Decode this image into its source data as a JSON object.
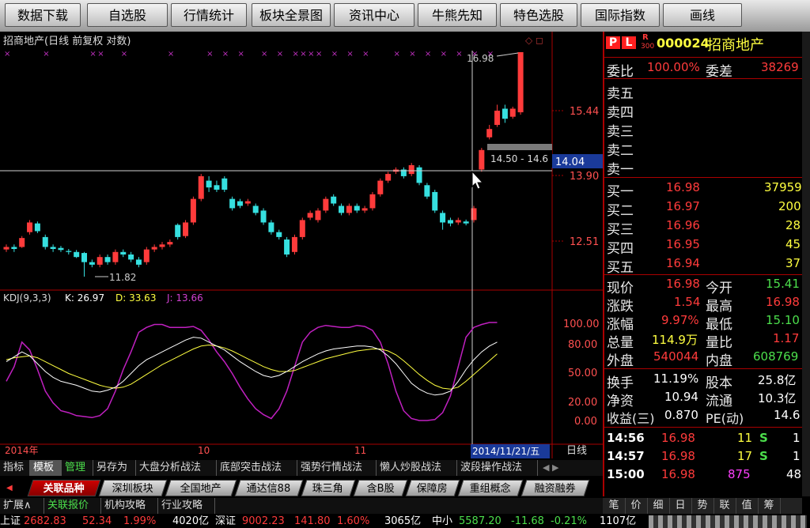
{
  "toolbar": {
    "buttons": [
      "数据下载",
      "自选股",
      "行情统计",
      "板块全景图",
      "资讯中心",
      "牛熊先知",
      "特色选股",
      "国际指数",
      "画线"
    ]
  },
  "chart": {
    "title": "招商地产(日线 前复权 对数)",
    "price_ticks": [
      "15.44",
      "13.90",
      "12.51"
    ],
    "high_label": "16.98",
    "low_label": "11.82",
    "crosshair_price": "14.04",
    "tooltip": "14.50 - 14.6",
    "kdj_header": {
      "name": "KDJ(9,3,3)",
      "k": "K: 26.97",
      "d": "D: 33.63",
      "j": "J: 13.66"
    },
    "kdj_ticks": [
      "100.00",
      "80.00",
      "50.00",
      "20.00",
      "0.00"
    ],
    "x_labels": [
      "2014年",
      "10",
      "11"
    ],
    "crosshair_date": "2014/11/21/五",
    "period": "日线"
  },
  "chart_data": [
    {
      "type": "candlestick",
      "title": "招商地产(日线 前复权 对数)",
      "price_ticks": [
        15.44,
        13.9,
        12.51
      ],
      "annotations": {
        "high": 16.98,
        "low": 11.82,
        "cursor_price": 14.04
      },
      "candles": [
        {
          "o": 12.35,
          "c": 12.4,
          "h": 12.45,
          "l": 12.3
        },
        {
          "o": 12.4,
          "c": 12.36,
          "h": 12.45,
          "l": 12.3
        },
        {
          "o": 12.4,
          "c": 12.58,
          "h": 12.62,
          "l": 12.38
        },
        {
          "o": 12.7,
          "c": 12.9,
          "h": 12.95,
          "l": 12.65
        },
        {
          "o": 12.88,
          "c": 12.72,
          "h": 12.92,
          "l": 12.68
        },
        {
          "o": 12.6,
          "c": 12.4,
          "h": 12.65,
          "l": 12.35
        },
        {
          "o": 12.4,
          "c": 12.36,
          "h": 12.45,
          "l": 12.3
        },
        {
          "o": 12.38,
          "c": 12.34,
          "h": 12.42,
          "l": 12.3
        },
        {
          "o": 12.32,
          "c": 12.3,
          "h": 12.36,
          "l": 12.25
        },
        {
          "o": 12.3,
          "c": 12.2,
          "h": 12.34,
          "l": 12.18
        },
        {
          "o": 12.28,
          "c": 12.1,
          "h": 12.3,
          "l": 11.82
        },
        {
          "o": 12.1,
          "c": 12.05,
          "h": 12.15,
          "l": 12.0
        },
        {
          "o": 12.05,
          "c": 12.2,
          "h": 12.25,
          "l": 12.0
        },
        {
          "o": 12.2,
          "c": 12.1,
          "h": 12.25,
          "l": 12.05
        },
        {
          "o": 12.1,
          "c": 12.3,
          "h": 12.35,
          "l": 12.05
        },
        {
          "o": 12.3,
          "c": 12.25,
          "h": 12.35,
          "l": 12.2
        },
        {
          "o": 12.25,
          "c": 12.15,
          "h": 12.3,
          "l": 12.1
        },
        {
          "o": 12.15,
          "c": 12.05,
          "h": 12.2,
          "l": 12.0
        },
        {
          "o": 12.1,
          "c": 12.35,
          "h": 12.4,
          "l": 12.05
        },
        {
          "o": 12.35,
          "c": 12.4,
          "h": 12.45,
          "l": 12.3
        },
        {
          "o": 12.4,
          "c": 12.45,
          "h": 12.5,
          "l": 12.35
        },
        {
          "o": 12.45,
          "c": 12.5,
          "h": 12.55,
          "l": 12.4
        },
        {
          "o": 12.85,
          "c": 12.6,
          "h": 12.88,
          "l": 12.55
        },
        {
          "o": 12.62,
          "c": 12.9,
          "h": 12.95,
          "l": 12.58
        },
        {
          "o": 12.9,
          "c": 13.4,
          "h": 13.45,
          "l": 12.85
        },
        {
          "o": 13.4,
          "c": 13.9,
          "h": 13.95,
          "l": 13.35
        },
        {
          "o": 13.8,
          "c": 13.65,
          "h": 13.9,
          "l": 13.55
        },
        {
          "o": 13.7,
          "c": 13.6,
          "h": 13.8,
          "l": 13.55
        },
        {
          "o": 13.85,
          "c": 13.6,
          "h": 13.9,
          "l": 13.55
        },
        {
          "o": 13.4,
          "c": 13.2,
          "h": 13.45,
          "l": 13.15
        },
        {
          "o": 13.35,
          "c": 13.25,
          "h": 13.4,
          "l": 13.2
        },
        {
          "o": 13.3,
          "c": 13.35,
          "h": 13.4,
          "l": 13.25
        },
        {
          "o": 13.25,
          "c": 13.1,
          "h": 13.3,
          "l": 13.05
        },
        {
          "o": 13.15,
          "c": 12.9,
          "h": 13.2,
          "l": 12.85
        },
        {
          "o": 12.9,
          "c": 12.7,
          "h": 12.95,
          "l": 12.65
        },
        {
          "o": 12.7,
          "c": 12.6,
          "h": 12.75,
          "l": 12.55
        },
        {
          "o": 12.55,
          "c": 12.25,
          "h": 12.6,
          "l": 12.2
        },
        {
          "o": 12.3,
          "c": 12.6,
          "h": 12.65,
          "l": 12.25
        },
        {
          "o": 12.6,
          "c": 12.95,
          "h": 13.0,
          "l": 12.55
        },
        {
          "o": 13.0,
          "c": 13.1,
          "h": 13.15,
          "l": 12.95
        },
        {
          "o": 12.95,
          "c": 13.15,
          "h": 13.2,
          "l": 12.9
        },
        {
          "o": 13.15,
          "c": 13.4,
          "h": 13.45,
          "l": 13.1
        },
        {
          "o": 13.45,
          "c": 13.3,
          "h": 13.5,
          "l": 13.25
        },
        {
          "o": 13.25,
          "c": 13.1,
          "h": 13.3,
          "l": 13.05
        },
        {
          "o": 13.1,
          "c": 13.25,
          "h": 13.3,
          "l": 13.05
        },
        {
          "o": 13.25,
          "c": 13.15,
          "h": 13.3,
          "l": 13.1
        },
        {
          "o": 13.15,
          "c": 13.2,
          "h": 13.25,
          "l": 13.1
        },
        {
          "o": 13.2,
          "c": 13.5,
          "h": 13.55,
          "l": 13.15
        },
        {
          "o": 13.5,
          "c": 13.8,
          "h": 13.85,
          "l": 13.45
        },
        {
          "o": 13.8,
          "c": 13.95,
          "h": 14.0,
          "l": 13.75
        },
        {
          "o": 14.0,
          "c": 14.05,
          "h": 14.1,
          "l": 13.95
        },
        {
          "o": 14.05,
          "c": 13.9,
          "h": 14.1,
          "l": 13.85
        },
        {
          "o": 13.95,
          "c": 14.15,
          "h": 14.2,
          "l": 13.9
        },
        {
          "o": 14.1,
          "c": 13.75,
          "h": 14.15,
          "l": 13.7
        },
        {
          "o": 13.7,
          "c": 13.45,
          "h": 13.75,
          "l": 13.4
        },
        {
          "o": 13.55,
          "c": 13.15,
          "h": 13.6,
          "l": 13.1
        },
        {
          "o": 13.1,
          "c": 12.9,
          "h": 13.15,
          "l": 12.75
        },
        {
          "o": 12.95,
          "c": 12.88,
          "h": 13.0,
          "l": 12.82
        },
        {
          "o": 12.9,
          "c": 12.95,
          "h": 13.0,
          "l": 12.85
        },
        {
          "o": 12.92,
          "c": 12.88,
          "h": 12.96,
          "l": 12.84
        },
        {
          "o": 12.95,
          "c": 13.2,
          "h": 13.25,
          "l": 12.9
        },
        {
          "o": 14.05,
          "c": 14.5,
          "h": 14.55,
          "l": 14.0
        },
        {
          "o": 14.8,
          "c": 15.0,
          "h": 15.1,
          "l": 14.75
        },
        {
          "o": 15.1,
          "c": 15.45,
          "h": 15.6,
          "l": 15.05
        },
        {
          "o": 15.5,
          "c": 15.25,
          "h": 15.6,
          "l": 15.15
        },
        {
          "o": 15.3,
          "c": 15.5,
          "h": 15.55,
          "l": 15.25
        },
        {
          "o": 15.41,
          "c": 16.98,
          "h": 16.98,
          "l": 15.35
        }
      ]
    },
    {
      "type": "line",
      "title": "KDJ(9,3,3)",
      "y_ticks": [
        100,
        80,
        50,
        20,
        0
      ],
      "series": [
        {
          "name": "K",
          "values": [
            60,
            65,
            70,
            66,
            58,
            50,
            44,
            40,
            38,
            36,
            33,
            30,
            29,
            31,
            34,
            40,
            48,
            56,
            62,
            66,
            70,
            74,
            78,
            82,
            85,
            84,
            80,
            76,
            72,
            66,
            60,
            55,
            50,
            46,
            44,
            46,
            50,
            55,
            60,
            64,
            68,
            71,
            73,
            74,
            75,
            76,
            76,
            75,
            72,
            66,
            58,
            48,
            38,
            32,
            28,
            26,
            27,
            30,
            40,
            52,
            62,
            70,
            76,
            80
          ]
        },
        {
          "name": "D",
          "values": [
            62,
            64,
            65,
            66,
            64,
            60,
            56,
            52,
            48,
            45,
            42,
            39,
            36,
            34,
            33,
            34,
            37,
            42,
            47,
            52,
            57,
            61,
            65,
            69,
            73,
            76,
            77,
            76,
            74,
            71,
            67,
            63,
            59,
            55,
            52,
            50,
            50,
            51,
            54,
            57,
            60,
            63,
            65,
            67,
            69,
            71,
            72,
            73,
            73,
            71,
            67,
            61,
            54,
            47,
            41,
            36,
            33,
            32,
            34,
            40,
            47,
            54,
            61,
            68
          ]
        },
        {
          "name": "J",
          "values": [
            40,
            55,
            80,
            72,
            52,
            30,
            18,
            10,
            8,
            5,
            4,
            3,
            5,
            12,
            30,
            52,
            70,
            90,
            95,
            98,
            98,
            95,
            95,
            95,
            96,
            92,
            82,
            70,
            60,
            48,
            34,
            22,
            12,
            6,
            2,
            12,
            30,
            55,
            80,
            90,
            95,
            97,
            96,
            95,
            95,
            97,
            96,
            92,
            80,
            58,
            30,
            10,
            2,
            0,
            0,
            1,
            8,
            25,
            55,
            85,
            95,
            98,
            100,
            100
          ]
        }
      ]
    }
  ],
  "quote": {
    "badge_p": "P",
    "badge_l": "L",
    "badge_r": "R",
    "badge_300": "300",
    "code": "000024",
    "name": "招商地产",
    "weibi_label": "委比",
    "weibi_value": "100.00%",
    "weicha_label": "委差",
    "weicha_value": "38269",
    "sell_labels": [
      "卖五",
      "卖四",
      "卖三",
      "卖二",
      "卖一"
    ],
    "buy_levels": [
      {
        "label": "买一",
        "price": "16.98",
        "vol": "37959"
      },
      {
        "label": "买二",
        "price": "16.97",
        "vol": "200"
      },
      {
        "label": "买三",
        "price": "16.96",
        "vol": "28"
      },
      {
        "label": "买四",
        "price": "16.95",
        "vol": "45"
      },
      {
        "label": "买五",
        "price": "16.94",
        "vol": "37"
      }
    ],
    "stats": [
      {
        "l1": "现价",
        "v1": "16.98",
        "l2": "今开",
        "v2": "15.41"
      },
      {
        "l1": "涨跌",
        "v1": "1.54",
        "l2": "最高",
        "v2": "16.98"
      },
      {
        "l1": "涨幅",
        "v1": "9.97%",
        "l2": "最低",
        "v2": "15.10"
      },
      {
        "l1": "总量",
        "v1": "114.9万",
        "l2": "量比",
        "v2": "1.17"
      },
      {
        "l1": "外盘",
        "v1": "540044",
        "l2": "内盘",
        "v2": "608769"
      }
    ],
    "fin": [
      {
        "l1": "换手",
        "v1": "11.19%",
        "l2": "股本",
        "v2": "25.8亿"
      },
      {
        "l1": "净资",
        "v1": "10.94",
        "l2": "流通",
        "v2": "10.3亿"
      },
      {
        "l1": "收益(三)",
        "v1": "0.870",
        "l2": "PE(动)",
        "v2": "14.6"
      }
    ],
    "ticks": [
      {
        "time": "14:56",
        "price": "16.98",
        "vol": "11",
        "bs": "S",
        "n": "1"
      },
      {
        "time": "14:57",
        "price": "16.98",
        "vol": "17",
        "bs": "S",
        "n": "1"
      },
      {
        "time": "15:00",
        "price": "16.98",
        "vol": "875",
        "bs": "",
        "n": "48"
      }
    ]
  },
  "tabs_row1": [
    "指标",
    "模板",
    "管理",
    "另存为",
    "大盘分析战法",
    "底部突击战法",
    "强势行情战法",
    "懒人炒股战法",
    "波段操作战法"
  ],
  "tabs_row2": [
    "关联品种",
    "深圳板块",
    "全国地产",
    "通达信88",
    "珠三角",
    "含B股",
    "保障房",
    "重组概念",
    "融资融券"
  ],
  "tabs_row3": [
    "扩展∧",
    "关联报价",
    "机构攻略",
    "行业攻略"
  ],
  "right_tabs": [
    "笔",
    "价",
    "细",
    "日",
    "势",
    "联",
    "值",
    "筹"
  ],
  "status": {
    "sh_label": "上证",
    "sh_index": "2682.83",
    "sh_change": "52.34",
    "sh_pct": "1.99%",
    "sh_amt": "4020亿",
    "sz_label": "深证",
    "sz_index": "9002.23",
    "sz_change": "141.80",
    "sz_pct": "1.60%",
    "sz_amt": "3065亿",
    "zx_label": "中小",
    "zx_index": "5587.20",
    "zx_change": "-11.68",
    "zx_pct": "-0.21%",
    "zx_amt": "1107亿"
  },
  "colors": {
    "up": "#ff3b3b",
    "down": "#36e0e0",
    "k_line": "#ffffff",
    "d_line": "#ffff40",
    "j_line": "#c020c0",
    "frame": "#aa0000"
  }
}
